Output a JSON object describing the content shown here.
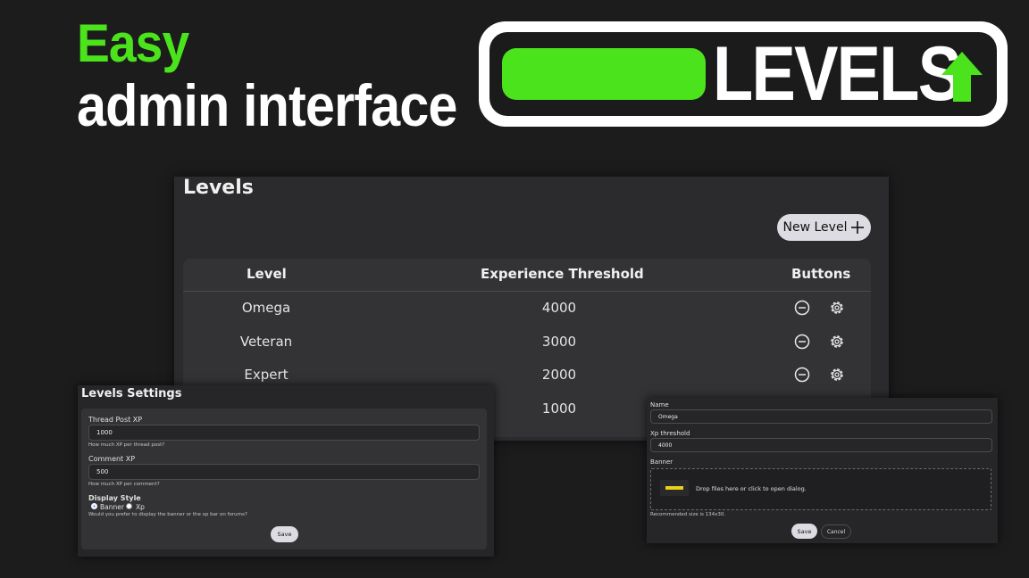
{
  "hero": {
    "line1": "Easy",
    "line2": "admin interface",
    "banner_text": "LEVELS",
    "banner_icon": "up-arrow-icon",
    "accent": "#4be31b"
  },
  "levels_panel": {
    "title": "Levels",
    "new_level_label": "New Level",
    "new_level_icon": "plus-icon",
    "columns": [
      "Level",
      "Experience Threshold",
      "Buttons"
    ],
    "rows": [
      {
        "name": "Omega",
        "threshold": "4000"
      },
      {
        "name": "Veteran",
        "threshold": "3000"
      },
      {
        "name": "Expert",
        "threshold": "2000"
      },
      {
        "name": "",
        "threshold": "1000"
      }
    ],
    "row_icons": [
      "remove-icon",
      "gear-icon"
    ]
  },
  "settings_panel": {
    "title": "Levels Settings",
    "thread_post_label": "Thread Post XP",
    "thread_post_value": "1000",
    "thread_post_hint": "How much XP per thread post?",
    "comment_label": "Comment XP",
    "comment_value": "500",
    "comment_hint": "How much XP per comment?",
    "display_style_label": "Display Style",
    "option_banner": "Banner",
    "option_xp": "Xp",
    "display_style_hint": "Would you prefer to display the banner or the xp bar on forums?",
    "save_label": "Save"
  },
  "edit_panel": {
    "name_label": "Name",
    "name_value": "Omega",
    "xp_label": "Xp threshold",
    "xp_value": "4000",
    "banner_label": "Banner",
    "drop_text": "Drop files here or click to open dialog.",
    "size_hint": "Recommended size is 134x30.",
    "save_label": "Save",
    "cancel_label": "Cancel"
  }
}
